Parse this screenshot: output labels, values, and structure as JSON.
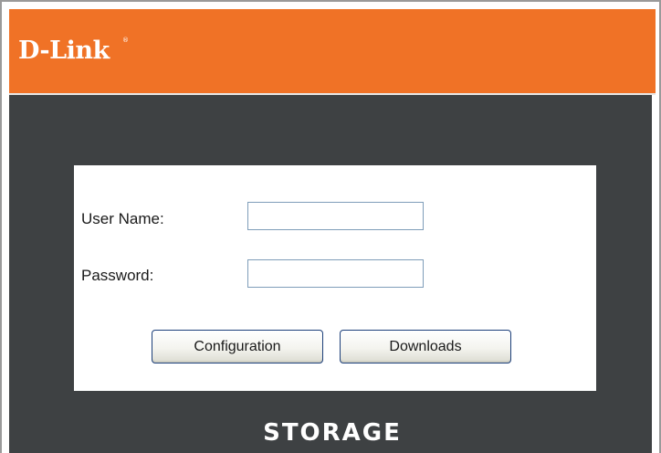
{
  "header": {
    "logo_text": "D-Link",
    "logo_mark": "®",
    "brand_color": "#f07226",
    "background_color": "#3e4143"
  },
  "login": {
    "username_label": "User Name:",
    "username_value": "",
    "password_label": "Password:",
    "password_value": "",
    "configuration_button": "Configuration",
    "downloads_button": "Downloads"
  },
  "footer": {
    "storage_text": "STORAGE"
  }
}
